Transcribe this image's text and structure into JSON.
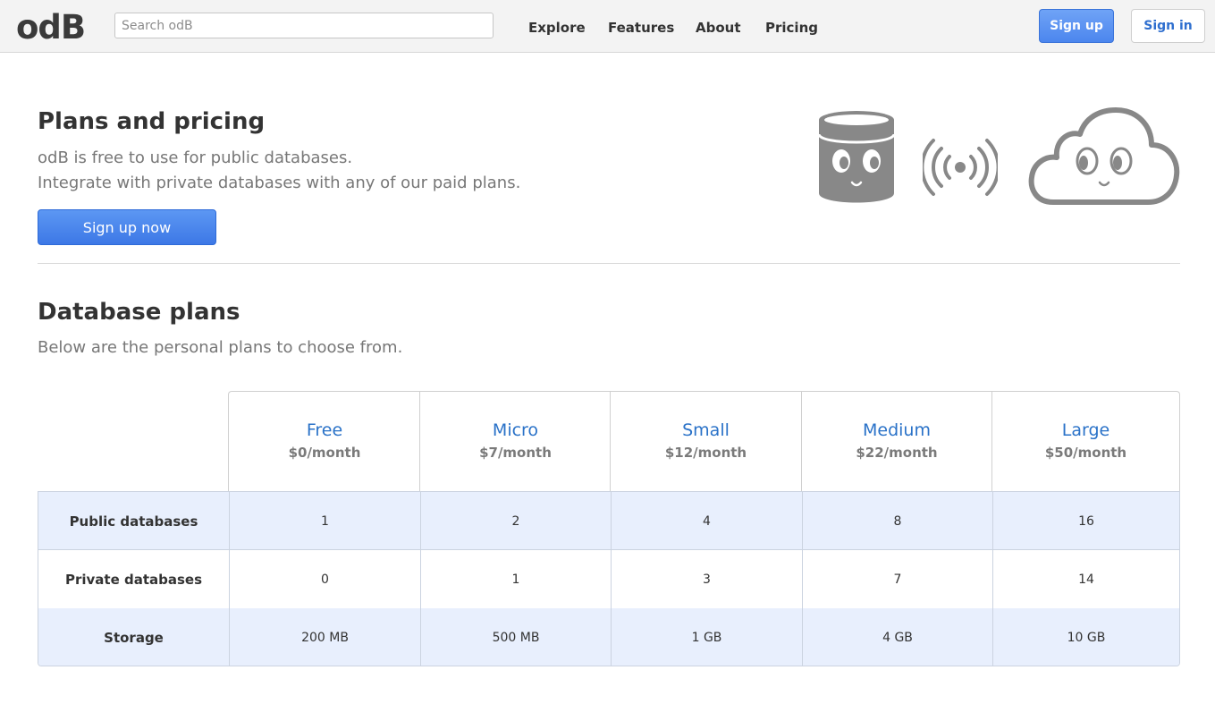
{
  "header": {
    "logo": "odB",
    "search_placeholder": "Search odB",
    "nav": [
      "Explore",
      "Features",
      "About",
      "Pricing"
    ],
    "signup_label": "Sign up",
    "signin_label": "Sign in"
  },
  "hero": {
    "title": "Plans and pricing",
    "line1": "odB is free to use for public databases.",
    "line2": "Integrate with private databases with any of our paid plans.",
    "cta_label": "Sign up now",
    "illustration_icons": [
      "database-face-icon",
      "signal-broadcast-icon",
      "cloud-face-icon"
    ]
  },
  "plans_section": {
    "title": "Database plans",
    "subtitle": "Below are the personal plans to choose from."
  },
  "table": {
    "plans": [
      {
        "name": "Free",
        "price": "$0/month"
      },
      {
        "name": "Micro",
        "price": "$7/month"
      },
      {
        "name": "Small",
        "price": "$12/month"
      },
      {
        "name": "Medium",
        "price": "$22/month"
      },
      {
        "name": "Large",
        "price": "$50/month"
      }
    ],
    "rows": [
      {
        "label": "Public databases",
        "values": [
          "1",
          "2",
          "4",
          "8",
          "16"
        ]
      },
      {
        "label": "Private databases",
        "values": [
          "0",
          "1",
          "3",
          "7",
          "14"
        ]
      },
      {
        "label": "Storage",
        "values": [
          "200 MB",
          "500 MB",
          "1 GB",
          "4 GB",
          "10 GB"
        ]
      }
    ]
  },
  "colors": {
    "accent_blue": "#4c86ee",
    "plan_name_blue": "#2a72c8",
    "row_shade": "#e8effd",
    "icon_gray": "#888888"
  }
}
